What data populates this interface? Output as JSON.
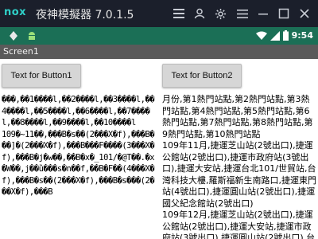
{
  "emulator": {
    "logo": "nox",
    "title": "夜神模擬器 7.0.1.5",
    "icons": [
      "menu-icon",
      "user-icon",
      "settings-icon",
      "hamburger-icon",
      "minimize-icon",
      "maximize-icon",
      "close-icon"
    ]
  },
  "status_bar": {
    "time": "9:54",
    "icons": [
      "diamond-icon",
      "android-icon",
      "wifi-icon",
      "signal-icon",
      "battery-icon"
    ]
  },
  "app_bar": {
    "title": "Screen1"
  },
  "buttons": {
    "button1_label": "Text for Button1",
    "button2_label": "Text for Button2"
  },
  "content": {
    "left_text": "���,��1����l,��2����l,��3����l,��4����l,��5����l,��6����l,��7����l,��8����l,��9����l,��10����l\n109�~11��,���B�s��(2���X�f),���B���]�(2���X�f),���B���F����(3���X�f),���B�j�w��,��B�x�_101/�@T��.�x�W��,j��ȕ���s�n��f,��B�F��(4���X�f),���B�s��(2���X�f),���B�s���(2���X�f),���B",
    "right_text": "月份,第1熱門站點,第2熱門站點,第3熱門站點,第4熱門站點,第5熱門站點,第6熱門站點,第7熱門站點,第8熱門站點,第9熱門站點,第10熱門站點\n109年11月,捷運芝山站(2號出口),捷運公館站(2號出口),捷運市政府站(3號出口),捷運大安站,捷運台北101/世貿站,台灣科技大樓,羅斯福新生南路口,捷運東門站(4號出口),捷運圓山站(2號出口),捷運國父紀念館站(2號出口)\n109年12月,捷運芝山站(2號出口),捷運公館站(2號出口),捷運大安站,捷運市政府站(3號出口),捷運圓山站(2號出口),台灣科技大樓,羅斯福新生南路口,捷運"
  }
}
